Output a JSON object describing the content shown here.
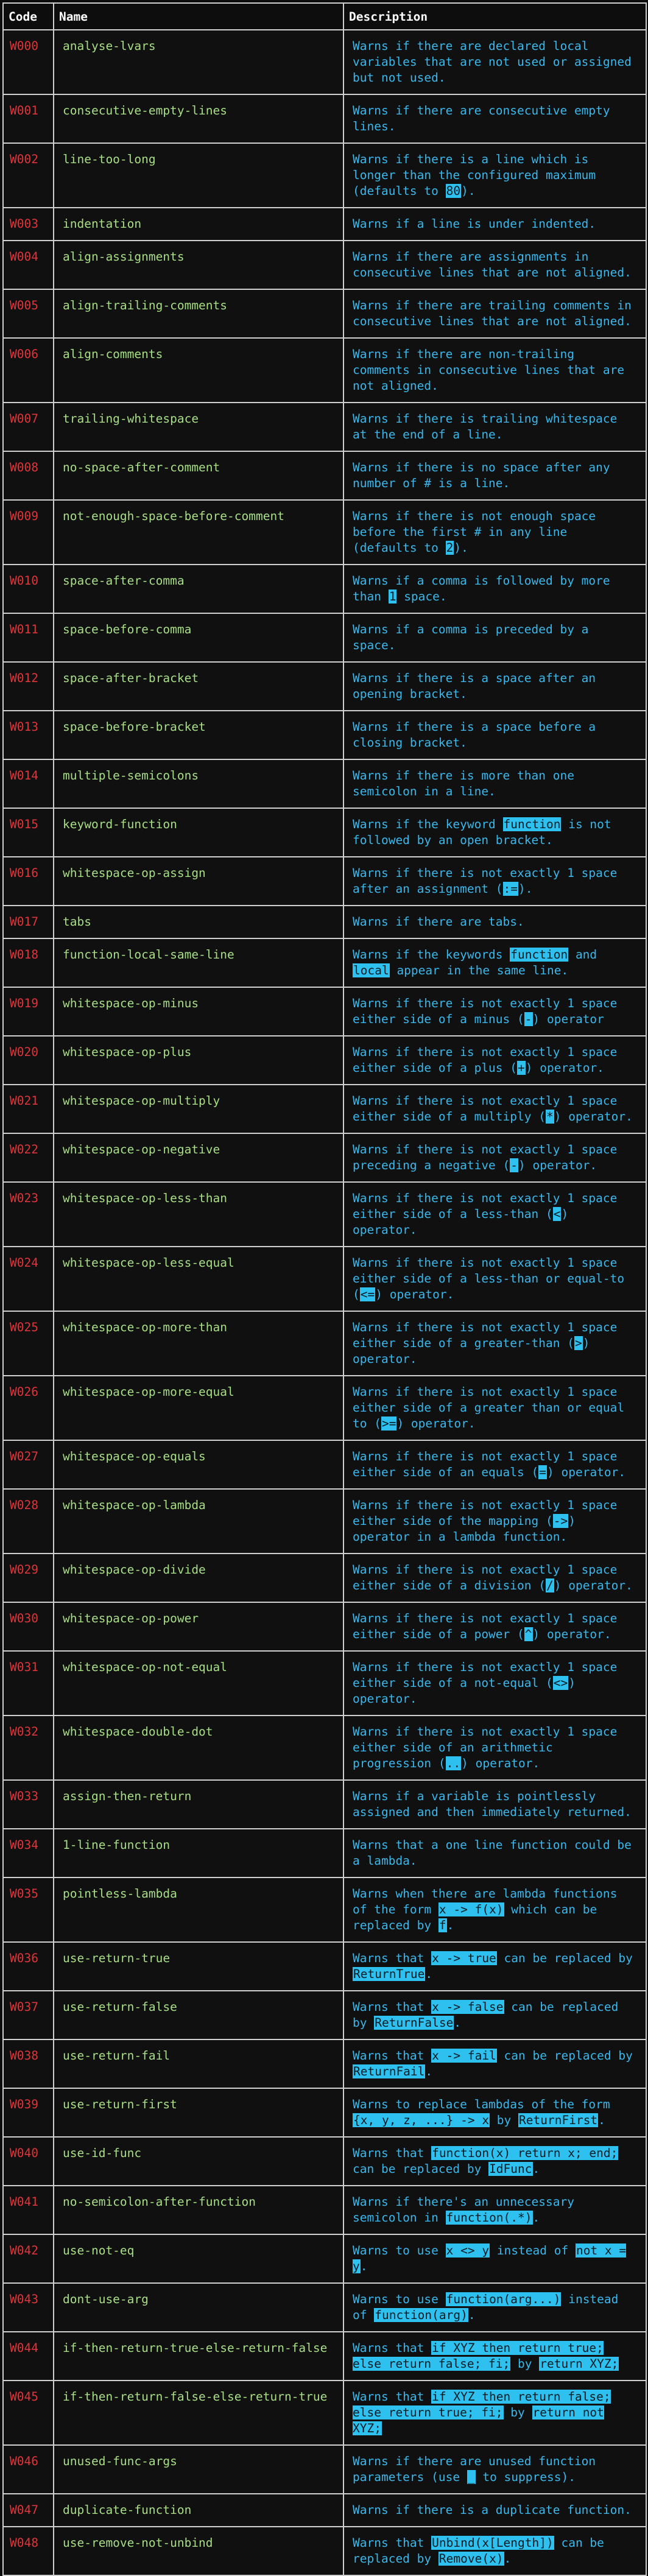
{
  "headers": {
    "code": "Code",
    "name": "Name",
    "description": "Description"
  },
  "rows": [
    {
      "code": "W000",
      "name": "analyse-lvars",
      "desc": [
        {
          "t": "Warns if there are declared local variables that are not used or assigned but not used."
        }
      ]
    },
    {
      "code": "W001",
      "name": "consecutive-empty-lines",
      "desc": [
        {
          "t": "Warns if there are consecutive empty lines."
        }
      ]
    },
    {
      "code": "W002",
      "name": "line-too-long",
      "desc": [
        {
          "t": "Warns if there is a line which is longer than the configured maximum (defaults to "
        },
        {
          "t": "80",
          "h": true
        },
        {
          "t": ")."
        }
      ]
    },
    {
      "code": "W003",
      "name": "indentation",
      "desc": [
        {
          "t": "Warns if a line is under indented."
        }
      ]
    },
    {
      "code": "W004",
      "name": "align-assignments",
      "desc": [
        {
          "t": "Warns if there are assignments in consecutive lines that are not aligned."
        }
      ]
    },
    {
      "code": "W005",
      "name": "align-trailing-comments",
      "desc": [
        {
          "t": "Warns if there are trailing comments in consecutive lines that are not aligned."
        }
      ]
    },
    {
      "code": "W006",
      "name": "align-comments",
      "desc": [
        {
          "t": "Warns if there are non-trailing comments in consecutive lines that are not aligned."
        }
      ]
    },
    {
      "code": "W007",
      "name": "trailing-whitespace",
      "desc": [
        {
          "t": "Warns if there is trailing whitespace at the end of a line."
        }
      ]
    },
    {
      "code": "W008",
      "name": "no-space-after-comment",
      "desc": [
        {
          "t": "Warns if there is no space after any number of # is a line."
        }
      ]
    },
    {
      "code": "W009",
      "name": "not-enough-space-before-comment",
      "desc": [
        {
          "t": "Warns if there is not enough space before the first # in any line (defaults to "
        },
        {
          "t": "2",
          "h": true
        },
        {
          "t": ")."
        }
      ]
    },
    {
      "code": "W010",
      "name": "space-after-comma",
      "desc": [
        {
          "t": "Warns if a comma is followed by more than "
        },
        {
          "t": "1",
          "h": true
        },
        {
          "t": " space."
        }
      ]
    },
    {
      "code": "W011",
      "name": "space-before-comma",
      "desc": [
        {
          "t": "Warns if a comma is preceded by a space."
        }
      ]
    },
    {
      "code": "W012",
      "name": "space-after-bracket",
      "desc": [
        {
          "t": "Warns if there is a space after an opening bracket."
        }
      ]
    },
    {
      "code": "W013",
      "name": "space-before-bracket",
      "desc": [
        {
          "t": "Warns if there is a space before a closing bracket."
        }
      ]
    },
    {
      "code": "W014",
      "name": "multiple-semicolons",
      "desc": [
        {
          "t": "Warns if there is more than one semicolon in a line."
        }
      ]
    },
    {
      "code": "W015",
      "name": "keyword-function",
      "desc": [
        {
          "t": "Warns if the keyword "
        },
        {
          "t": "function",
          "h": true
        },
        {
          "t": " is not followed by an open bracket."
        }
      ]
    },
    {
      "code": "W016",
      "name": "whitespace-op-assign",
      "desc": [
        {
          "t": "Warns if there is not exactly 1 space after an assignment  ("
        },
        {
          "t": ":=",
          "h": true
        },
        {
          "t": ")."
        }
      ]
    },
    {
      "code": "W017",
      "name": "tabs",
      "desc": [
        {
          "t": "Warns if there are tabs."
        }
      ]
    },
    {
      "code": "W018",
      "name": "function-local-same-line",
      "desc": [
        {
          "t": "Warns if the keywords "
        },
        {
          "t": "function",
          "h": true
        },
        {
          "t": " and "
        },
        {
          "t": "local",
          "h": true
        },
        {
          "t": " appear in the same line."
        }
      ]
    },
    {
      "code": "W019",
      "name": "whitespace-op-minus",
      "desc": [
        {
          "t": "Warns if there is not exactly 1 space either side of a minus ("
        },
        {
          "t": "-",
          "h": true
        },
        {
          "t": ") operator"
        }
      ]
    },
    {
      "code": "W020",
      "name": "whitespace-op-plus",
      "desc": [
        {
          "t": "Warns if there is not exactly 1 space either side of a plus ("
        },
        {
          "t": "+",
          "h": true
        },
        {
          "t": ") operator."
        }
      ]
    },
    {
      "code": "W021",
      "name": "whitespace-op-multiply",
      "desc": [
        {
          "t": "Warns if there is not exactly 1 space either side of a multiply ("
        },
        {
          "t": "*",
          "h": true
        },
        {
          "t": ") operator."
        }
      ]
    },
    {
      "code": "W022",
      "name": "whitespace-op-negative",
      "desc": [
        {
          "t": "Warns if there is not exactly 1 space preceding a negative ("
        },
        {
          "t": "-",
          "h": true
        },
        {
          "t": ") operator."
        }
      ]
    },
    {
      "code": "W023",
      "name": "whitespace-op-less-than",
      "desc": [
        {
          "t": "Warns if there is not exactly 1 space either side of a less-than ("
        },
        {
          "t": "<",
          "h": true
        },
        {
          "t": ") operator."
        }
      ]
    },
    {
      "code": "W024",
      "name": "whitespace-op-less-equal",
      "desc": [
        {
          "t": "Warns if there is not exactly 1 space either side of a less-than or equal-to ("
        },
        {
          "t": "<=",
          "h": true
        },
        {
          "t": ") operator."
        }
      ]
    },
    {
      "code": "W025",
      "name": "whitespace-op-more-than",
      "desc": [
        {
          "t": "Warns if there is not exactly 1 space either side of a greater-than ("
        },
        {
          "t": ">",
          "h": true
        },
        {
          "t": ") operator."
        }
      ]
    },
    {
      "code": "W026",
      "name": "whitespace-op-more-equal",
      "desc": [
        {
          "t": "Warns if there is not exactly 1 space either side of a greater than or equal to ("
        },
        {
          "t": ">=",
          "h": true
        },
        {
          "t": ") operator."
        }
      ]
    },
    {
      "code": "W027",
      "name": "whitespace-op-equals",
      "desc": [
        {
          "t": "Warns if there is not exactly 1 space either side of an equals ("
        },
        {
          "t": "=",
          "h": true
        },
        {
          "t": ") operator."
        }
      ]
    },
    {
      "code": "W028",
      "name": "whitespace-op-lambda",
      "desc": [
        {
          "t": "Warns if there is not exactly 1 space either side of the mapping ("
        },
        {
          "t": "->",
          "h": true
        },
        {
          "t": ") operator in a lambda function."
        }
      ]
    },
    {
      "code": "W029",
      "name": "whitespace-op-divide",
      "desc": [
        {
          "t": "Warns if there is not exactly 1 space either side of a division ("
        },
        {
          "t": "/",
          "h": true
        },
        {
          "t": ") operator."
        }
      ]
    },
    {
      "code": "W030",
      "name": "whitespace-op-power",
      "desc": [
        {
          "t": "Warns if there is not exactly 1 space either side of a power ("
        },
        {
          "t": "^",
          "h": true
        },
        {
          "t": ") operator."
        }
      ]
    },
    {
      "code": "W031",
      "name": "whitespace-op-not-equal",
      "desc": [
        {
          "t": "Warns if there is not exactly 1 space either side of a not-equal ("
        },
        {
          "t": "<>",
          "h": true
        },
        {
          "t": ") operator."
        }
      ]
    },
    {
      "code": "W032",
      "name": "whitespace-double-dot",
      "desc": [
        {
          "t": "Warns if there is not exactly 1 space either side of an arithmetic progression ("
        },
        {
          "t": "..",
          "h": true
        },
        {
          "t": ") operator."
        }
      ]
    },
    {
      "code": "W033",
      "name": "assign-then-return",
      "desc": [
        {
          "t": "Warns if a variable is pointlessly assigned and then immediately returned."
        }
      ]
    },
    {
      "code": "W034",
      "name": "1-line-function",
      "desc": [
        {
          "t": "Warns that a one line function could be a lambda."
        }
      ]
    },
    {
      "code": "W035",
      "name": "pointless-lambda",
      "desc": [
        {
          "t": "Warns when there are lambda functions of the form "
        },
        {
          "t": "x -> f(x)",
          "h": true
        },
        {
          "t": " which can be replaced by "
        },
        {
          "t": "f",
          "h": true
        },
        {
          "t": "."
        }
      ]
    },
    {
      "code": "W036",
      "name": "use-return-true",
      "desc": [
        {
          "t": "Warns that "
        },
        {
          "t": "x -> true",
          "h": true
        },
        {
          "t": " can be replaced by "
        },
        {
          "t": "ReturnTrue",
          "h": true
        },
        {
          "t": "."
        }
      ]
    },
    {
      "code": "W037",
      "name": "use-return-false",
      "desc": [
        {
          "t": "Warns that "
        },
        {
          "t": "x -> false",
          "h": true
        },
        {
          "t": " can be replaced by "
        },
        {
          "t": "ReturnFalse",
          "h": true
        },
        {
          "t": "."
        }
      ]
    },
    {
      "code": "W038",
      "name": "use-return-fail",
      "desc": [
        {
          "t": "Warns that "
        },
        {
          "t": "x -> fail",
          "h": true
        },
        {
          "t": " can be replaced by "
        },
        {
          "t": "ReturnFail",
          "h": true
        },
        {
          "t": "."
        }
      ]
    },
    {
      "code": "W039",
      "name": "use-return-first",
      "desc": [
        {
          "t": "Warns to replace lambdas of the form "
        },
        {
          "t": "{x, y, z, ...} -> x",
          "h": true
        },
        {
          "t": " by "
        },
        {
          "t": "ReturnFirst",
          "h": true
        },
        {
          "t": "."
        }
      ]
    },
    {
      "code": "W040",
      "name": "use-id-func",
      "desc": [
        {
          "t": "Warns that "
        },
        {
          "t": "function(x) return x; end;",
          "h": true
        },
        {
          "t": " can be replaced by "
        },
        {
          "t": "IdFunc",
          "h": true
        },
        {
          "t": "."
        }
      ]
    },
    {
      "code": "W041",
      "name": "no-semicolon-after-function",
      "desc": [
        {
          "t": "Warns if there's an unnecessary semicolon in "
        },
        {
          "t": "function(.*)",
          "h": true
        },
        {
          "t": "."
        }
      ]
    },
    {
      "code": "W042",
      "name": "use-not-eq",
      "desc": [
        {
          "t": "Warns to use "
        },
        {
          "t": "x <> y",
          "h": true
        },
        {
          "t": " instead of "
        },
        {
          "t": "not x = y",
          "h": true
        },
        {
          "t": "."
        }
      ]
    },
    {
      "code": "W043",
      "name": "dont-use-arg",
      "desc": [
        {
          "t": "Warns to use "
        },
        {
          "t": "function(arg...)",
          "h": true
        },
        {
          "t": " instead of "
        },
        {
          "t": "function(arg)",
          "h": true
        },
        {
          "t": "."
        }
      ]
    },
    {
      "code": "W044",
      "name": "if-then-return-true-else-return-false",
      "desc": [
        {
          "t": "Warns that "
        },
        {
          "t": "if XYZ then return true; else return false; fi;",
          "h": true
        },
        {
          "t": " by "
        },
        {
          "t": "return XYZ;",
          "h": true
        }
      ]
    },
    {
      "code": "W045",
      "name": "if-then-return-false-else-return-true",
      "desc": [
        {
          "t": "Warns that "
        },
        {
          "t": "if XYZ then return false; else return true; fi;",
          "h": true
        },
        {
          "t": " by "
        },
        {
          "t": "return not XYZ;",
          "h": true
        }
      ]
    },
    {
      "code": "W046",
      "name": "unused-func-args",
      "desc": [
        {
          "t": "Warns if there are unused function parameters (use "
        },
        {
          "t": "_",
          "h": true
        },
        {
          "t": " to suppress)."
        }
      ]
    },
    {
      "code": "W047",
      "name": "duplicate-function",
      "desc": [
        {
          "t": "Warns if there is a duplicate function."
        }
      ]
    },
    {
      "code": "W048",
      "name": "use-remove-not-unbind",
      "desc": [
        {
          "t": "Warns that "
        },
        {
          "t": "Unbind(x[Length])",
          "h": true
        },
        {
          "t": " can be replaced by "
        },
        {
          "t": "Remove(x)",
          "h": true
        },
        {
          "t": "."
        }
      ]
    }
  ]
}
